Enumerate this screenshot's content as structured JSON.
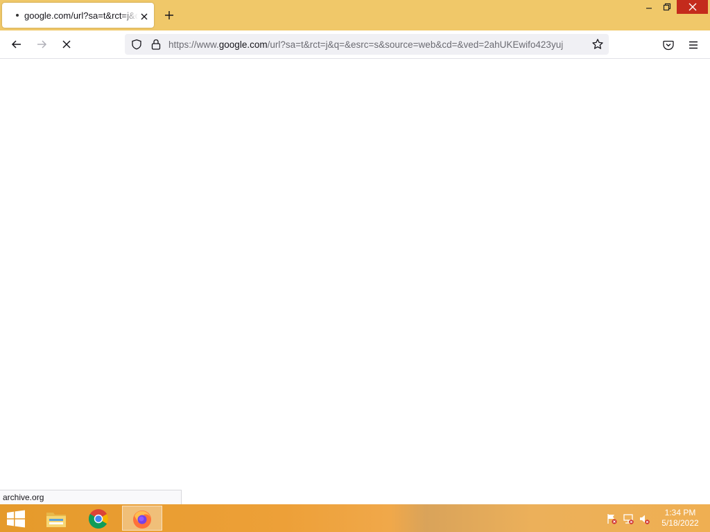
{
  "browser": {
    "tab": {
      "title": "google.com/url?sa=t&rct=j&q=&esrc=s&source=web&cd="
    },
    "url": {
      "prefix": "https://www.",
      "host": "google.com",
      "path": "/url?sa=t&rct=j&q=&esrc=s&source=web&cd=&ved=2ahUKEwifo423yuj"
    },
    "status_text": "archive.org"
  },
  "taskbar": {
    "apps": [
      "file-explorer",
      "chrome",
      "firefox"
    ],
    "clock": {
      "time": "1:34 PM",
      "date": "5/18/2022"
    }
  },
  "colors": {
    "tabstrip": "#f0c869",
    "taskbar": "#eda038",
    "close_button": "#c42b1c"
  }
}
